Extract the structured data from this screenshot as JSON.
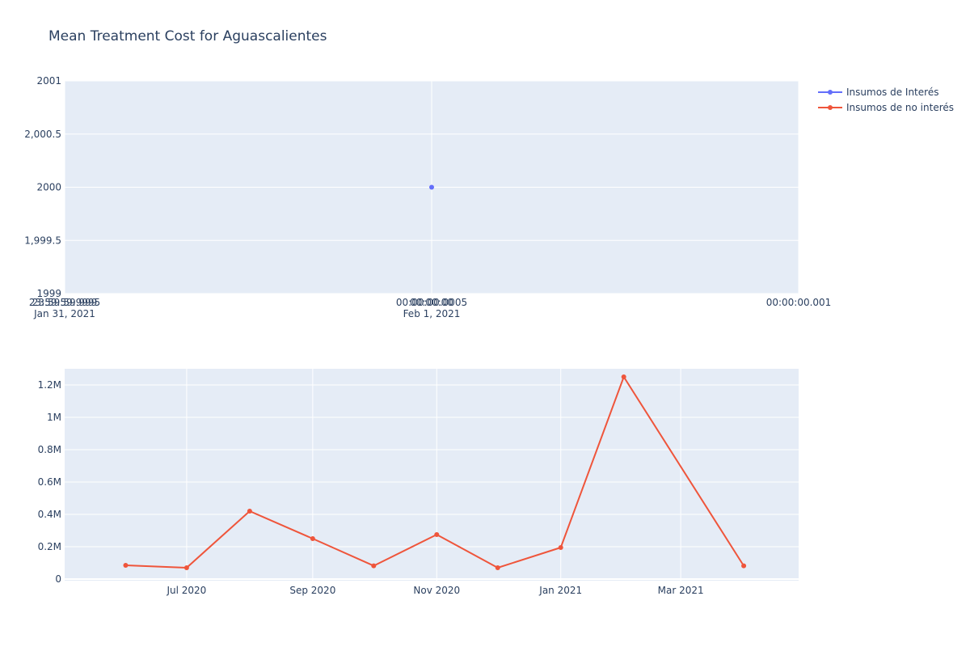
{
  "chart_data": [
    {
      "type": "scatter",
      "title": "Mean Treatment Cost for Aguascalientes",
      "xlabel": "",
      "ylabel": "",
      "legend": {
        "placement": "top-right",
        "entries": [
          {
            "name": "Insumos de Interés",
            "color": "#636efa"
          },
          {
            "name": "Insumos de no interés",
            "color": "#EF553B"
          }
        ]
      },
      "grid": true,
      "xlim": [
        "2021-01-31T23:59:59.999",
        "2021-02-01T00:00:00.001"
      ],
      "ylim": [
        1999,
        2001
      ],
      "x_ticks": [
        {
          "value": "2021-01-31T23:59:59.999",
          "line1": "23:59:59.999",
          "line2": "Jan 31, 2021"
        },
        {
          "value": "2021-01-31T23:59:59.9995",
          "line1": "23:59:59.9995",
          "line2": ""
        },
        {
          "value": "2021-02-01T00:00:00",
          "line1": "00:00:00",
          "line2": "Feb 1, 2021"
        },
        {
          "value": "2021-02-01T00:00:00.0005",
          "line1": "00:00:00.0005",
          "line2": ""
        },
        {
          "value": "2021-02-01T00:00:00.001",
          "line1": "00:00:00.001",
          "line2": ""
        }
      ],
      "y_ticks": [
        {
          "value": 1999,
          "label": "1999"
        },
        {
          "value": 1999.5,
          "label": "1,999.5"
        },
        {
          "value": 2000,
          "label": "2000"
        },
        {
          "value": 2000.5,
          "label": "2,000.5"
        },
        {
          "value": 2001,
          "label": "2001"
        }
      ],
      "series": [
        {
          "name": "Insumos de Interés",
          "color": "#636efa",
          "x": [
            "2021-02-01T00:00:00"
          ],
          "y": [
            2000
          ]
        }
      ]
    },
    {
      "type": "line",
      "title": "",
      "xlabel": "",
      "ylabel": "",
      "grid": true,
      "xlim": [
        "2020-05-02",
        "2021-04-28"
      ],
      "ylim": [
        -10000,
        1300000
      ],
      "x_ticks": [
        {
          "value": "2020-07-01",
          "label": "Jul 2020"
        },
        {
          "value": "2020-09-01",
          "label": "Sep 2020"
        },
        {
          "value": "2020-11-01",
          "label": "Nov 2020"
        },
        {
          "value": "2021-01-01",
          "label": "Jan 2021"
        },
        {
          "value": "2021-03-01",
          "label": "Mar 2021"
        }
      ],
      "y_ticks": [
        {
          "value": 0,
          "label": "0"
        },
        {
          "value": 200000,
          "label": "0.2M"
        },
        {
          "value": 400000,
          "label": "0.4M"
        },
        {
          "value": 600000,
          "label": "0.6M"
        },
        {
          "value": 800000,
          "label": "0.8M"
        },
        {
          "value": 1000000,
          "label": "1M"
        },
        {
          "value": 1200000,
          "label": "1.2M"
        }
      ],
      "series": [
        {
          "name": "Insumos de no interés",
          "color": "#EF553B",
          "x": [
            "2020-06-01",
            "2020-07-01",
            "2020-08-01",
            "2020-09-01",
            "2020-10-01",
            "2020-11-01",
            "2020-12-01",
            "2021-01-01",
            "2021-02-01",
            "2021-03-01",
            "2021-04-01"
          ],
          "y": [
            85000,
            70000,
            420000,
            250000,
            82000,
            275000,
            70000,
            195000,
            1250000,
            null,
            82000
          ]
        }
      ]
    }
  ]
}
